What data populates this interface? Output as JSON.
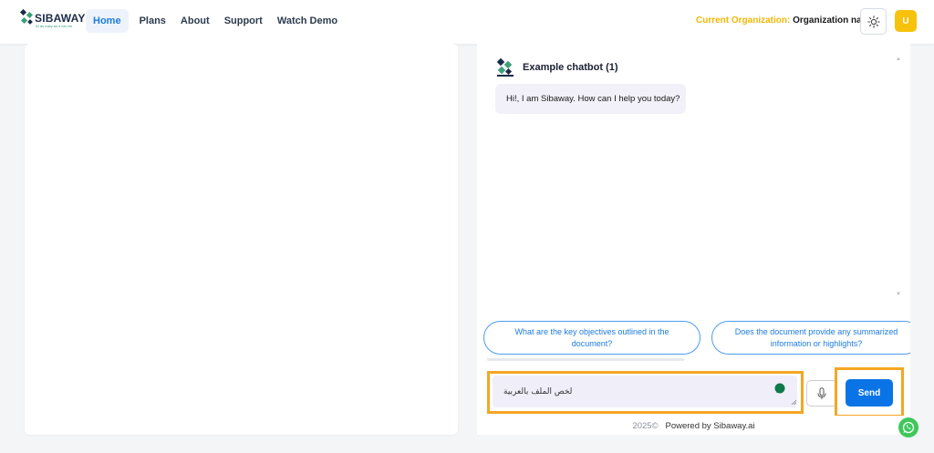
{
  "header": {
    "logo_text": "SIBAWAY",
    "logo_tagline": "AI as easy as it can be",
    "nav": [
      "Home",
      "Plans",
      "About",
      "Support",
      "Watch Demo"
    ],
    "org_label": "Current Organization:",
    "org_name": "Organization name",
    "theme_icon": "sun-icon",
    "avatar_initial": "U"
  },
  "chat": {
    "title": "Example chatbot (1)",
    "messages": [
      {
        "from": "bot",
        "text": "Hi!, I am Sibaway. How can I help you today?"
      }
    ],
    "suggestions": [
      "What are the key objectives outlined in the document?",
      "Does the document provide any summarized information or highlights?"
    ],
    "input_value": "لخص الملف بالعربية",
    "send_label": "Send",
    "mic_icon": "microphone-icon"
  },
  "footer": {
    "year": "2025©",
    "powered": "Powered by Sibaway.ai"
  },
  "colors": {
    "accent": "#0a74e6",
    "highlight": "#f5a623",
    "org_label": "#f2b705",
    "avatar": "#f6c20b",
    "whatsapp": "#3fc85a"
  }
}
